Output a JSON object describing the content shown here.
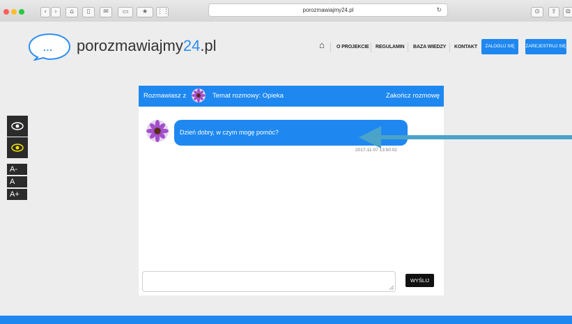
{
  "browser": {
    "url": "porozmawiajmy24.pl"
  },
  "header": {
    "logo_dots": "...",
    "logo_name": "porozmawiajmy",
    "logo_number": "24",
    "logo_tld": ".pl",
    "nav": [
      "O PROJEKCIE",
      "REGULAMIN",
      "BAZA WIEDZY",
      "KONTAKT"
    ],
    "login_label": "ZALOGUJ SIĘ",
    "register_label": "ZAREJESTRUJ SIĘ"
  },
  "accessibility": {
    "font_small": "A-",
    "font_normal": "A",
    "font_large": "A+"
  },
  "chat": {
    "talking_with": "Rozmawiasz z",
    "topic": "Temat rozmowy: Opieka",
    "end_label": "Zakończ rozmowę",
    "message_text": "Dzień dobry, w czym mogę pomóc?",
    "message_time": "2017-11-07 13:50:02",
    "send_label": "WYŚLIJ"
  },
  "colors": {
    "accent": "#1e88f0",
    "arrow": "#4aa3c9"
  }
}
